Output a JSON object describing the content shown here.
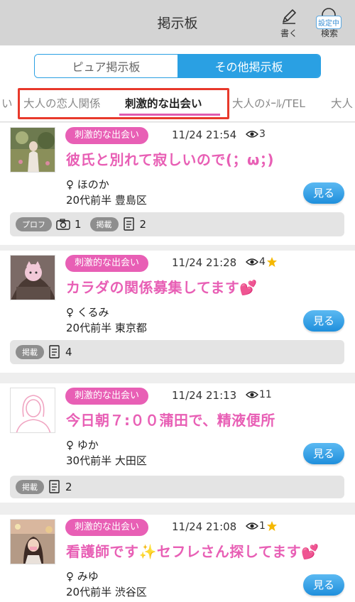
{
  "header": {
    "title": "掲示板",
    "write_label": "書く",
    "search_label": "検索",
    "search_badge": "設定中"
  },
  "board_toggle": {
    "options": [
      "ピュア掲示板",
      "その他掲示板"
    ],
    "selected": "その他掲示板"
  },
  "category_tabs": {
    "items": [
      "い",
      "大人の恋人関係",
      "刺激的な出会い",
      "大人のﾒｰﾙ/TEL",
      "大人"
    ],
    "active": "刺激的な出会い"
  },
  "posts": [
    {
      "category": "刺激的な出会い",
      "time": "11/24 21:54",
      "views": "3",
      "starred": false,
      "title": "彼氏と別れて寂しいので(；ω；)",
      "gender": "♀",
      "name": "ほのか",
      "age_area": "20代前半 豊島区",
      "button": "見る",
      "stats": [
        {
          "pill": "プロフ",
          "icon": "camera-icon",
          "count": "1"
        },
        {
          "pill": "掲載",
          "icon": "post-list-icon",
          "count": "2"
        }
      ]
    },
    {
      "category": "刺激的な出会い",
      "time": "11/24 21:28",
      "views": "4",
      "starred": true,
      "title": "カラダの関係募集してます",
      "emoji": "💕",
      "gender": "♀",
      "name": "くるみ",
      "age_area": "20代前半 東京都",
      "button": "見る",
      "stats": [
        {
          "pill": "掲載",
          "icon": "post-list-icon",
          "count": "4"
        }
      ]
    },
    {
      "category": "刺激的な出会い",
      "time": "11/24 21:13",
      "views": "11",
      "starred": false,
      "title": "今日朝７:００蒲田で、精液便所",
      "gender": "♀",
      "name": "ゆか",
      "age_area": "30代前半 大田区",
      "button": "見る",
      "stats": [
        {
          "pill": "掲載",
          "icon": "post-list-icon",
          "count": "2"
        }
      ]
    },
    {
      "category": "刺激的な出会い",
      "time": "11/24 21:08",
      "views": "1",
      "starred": true,
      "title": "看護師です✨セフレさん探してます",
      "emoji": "💕",
      "gender": "♀",
      "name": "みゆ",
      "age_area": "20代前半 渋谷区",
      "button": "見る",
      "stats": []
    }
  ],
  "colors": {
    "accent_blue": "#2aa0e3",
    "accent_pink": "#e85fb5",
    "highlight_red": "#e8392b",
    "header_bg": "#d4d4d4"
  }
}
